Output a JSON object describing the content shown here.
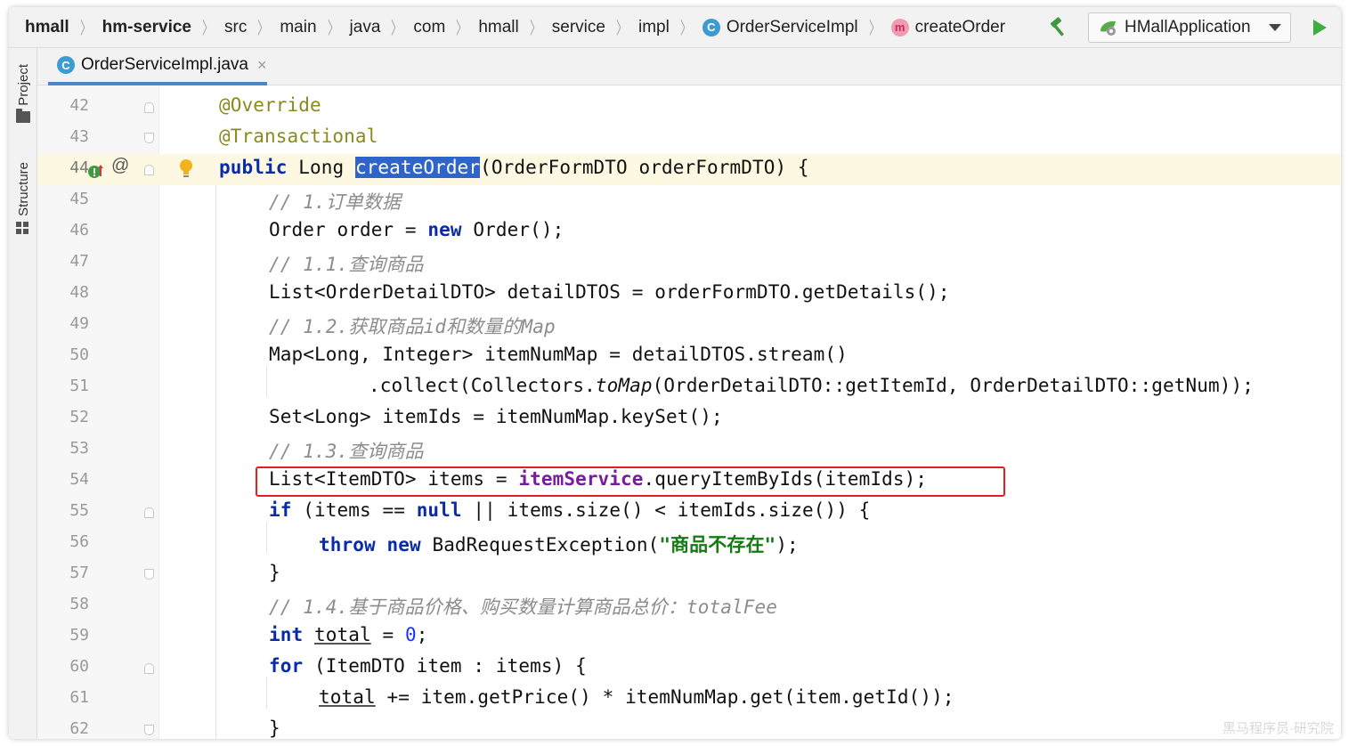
{
  "breadcrumb": {
    "items": [
      "hmall",
      "hm-service",
      "src",
      "main",
      "java",
      "com",
      "hmall",
      "service",
      "impl"
    ],
    "class_name": "OrderServiceImpl",
    "method_name": "createOrder",
    "class_icon_letter": "C",
    "method_icon_letter": "m"
  },
  "toolbar": {
    "run_config": "HMallApplication"
  },
  "toolstrip": {
    "project_label": "Project",
    "structure_label": "Structure"
  },
  "tab": {
    "file_name": "OrderServiceImpl.java",
    "icon_letter": "C",
    "close_glyph": "×"
  },
  "gutter": {
    "at_glyph": "@"
  },
  "code": {
    "current_line": 44,
    "lines": [
      {
        "n": "42"
      },
      {
        "n": "43"
      },
      {
        "n": "44"
      },
      {
        "n": "45"
      },
      {
        "n": "46"
      },
      {
        "n": "47"
      },
      {
        "n": "48"
      },
      {
        "n": "49"
      },
      {
        "n": "50"
      },
      {
        "n": "51"
      },
      {
        "n": "52"
      },
      {
        "n": "53"
      },
      {
        "n": "54"
      },
      {
        "n": "55"
      },
      {
        "n": "56"
      },
      {
        "n": "57"
      },
      {
        "n": "58"
      },
      {
        "n": "59"
      },
      {
        "n": "60"
      },
      {
        "n": "61"
      },
      {
        "n": "62"
      }
    ],
    "t": {
      "l42_ann": "@Override",
      "l43_ann": "@Transactional",
      "l44_kw": "public",
      "l44_a": " Long ",
      "l44_sel": "createOrder",
      "l44_b": "(OrderFormDTO orderFormDTO) {",
      "l45_cmt": "// 1.订单数据",
      "l46_a": "Order order = ",
      "l46_kw": "new",
      "l46_b": " Order();",
      "l47_cmt": "// 1.1.查询商品",
      "l48": "List<OrderDetailDTO> detailDTOS = orderFormDTO.getDetails();",
      "l49_cmt": "// 1.2.获取商品id和数量的Map",
      "l50": "Map<Long, Integer> itemNumMap = detailDTOS.stream()",
      "l51_a": ".collect(Collectors.",
      "l51_it": "toMap",
      "l51_b": "(OrderDetailDTO::getItemId, OrderDetailDTO::getNum));",
      "l52": "Set<Long> itemIds = itemNumMap.keySet();",
      "l53_cmt": "// 1.3.查询商品",
      "l54_a": "List<ItemDTO> items = ",
      "l54_fld": "itemService",
      "l54_b": ".queryItemByIds(itemIds);",
      "l55_kw1": "if",
      "l55_a": " (items == ",
      "l55_kw2": "null",
      "l55_b": " || items.size() < itemIds.size()) {",
      "l56_kw1": "throw",
      "l56_sp": " ",
      "l56_kw2": "new",
      "l56_a": " BadRequestException(",
      "l56_str": "\"商品不存在\"",
      "l56_b": ");",
      "l57": "}",
      "l58_cmt": "// 1.4.基于商品价格、购买数量计算商品总价：totalFee",
      "l59_kw": "int",
      "l59_sp": " ",
      "l59_ul": "total",
      "l59_a": " = ",
      "l59_num": "0",
      "l59_b": ";",
      "l60_kw": "for",
      "l60_a": " (ItemDTO item : items) {",
      "l61_ul": "total",
      "l61_a": " += item.getPrice() * itemNumMap.get(item.getId());",
      "l62": "}"
    }
  },
  "colors": {
    "keyword": "#0a2ba8",
    "annotation": "#8a8a1e",
    "comment": "#8c8c8c",
    "string": "#147b14",
    "field": "#7a1a9e",
    "selection": "#2f65ca",
    "highlight_box": "#e01f1f",
    "current_line": "#fdf8e2"
  },
  "watermark": "黑马程序员·研究院"
}
